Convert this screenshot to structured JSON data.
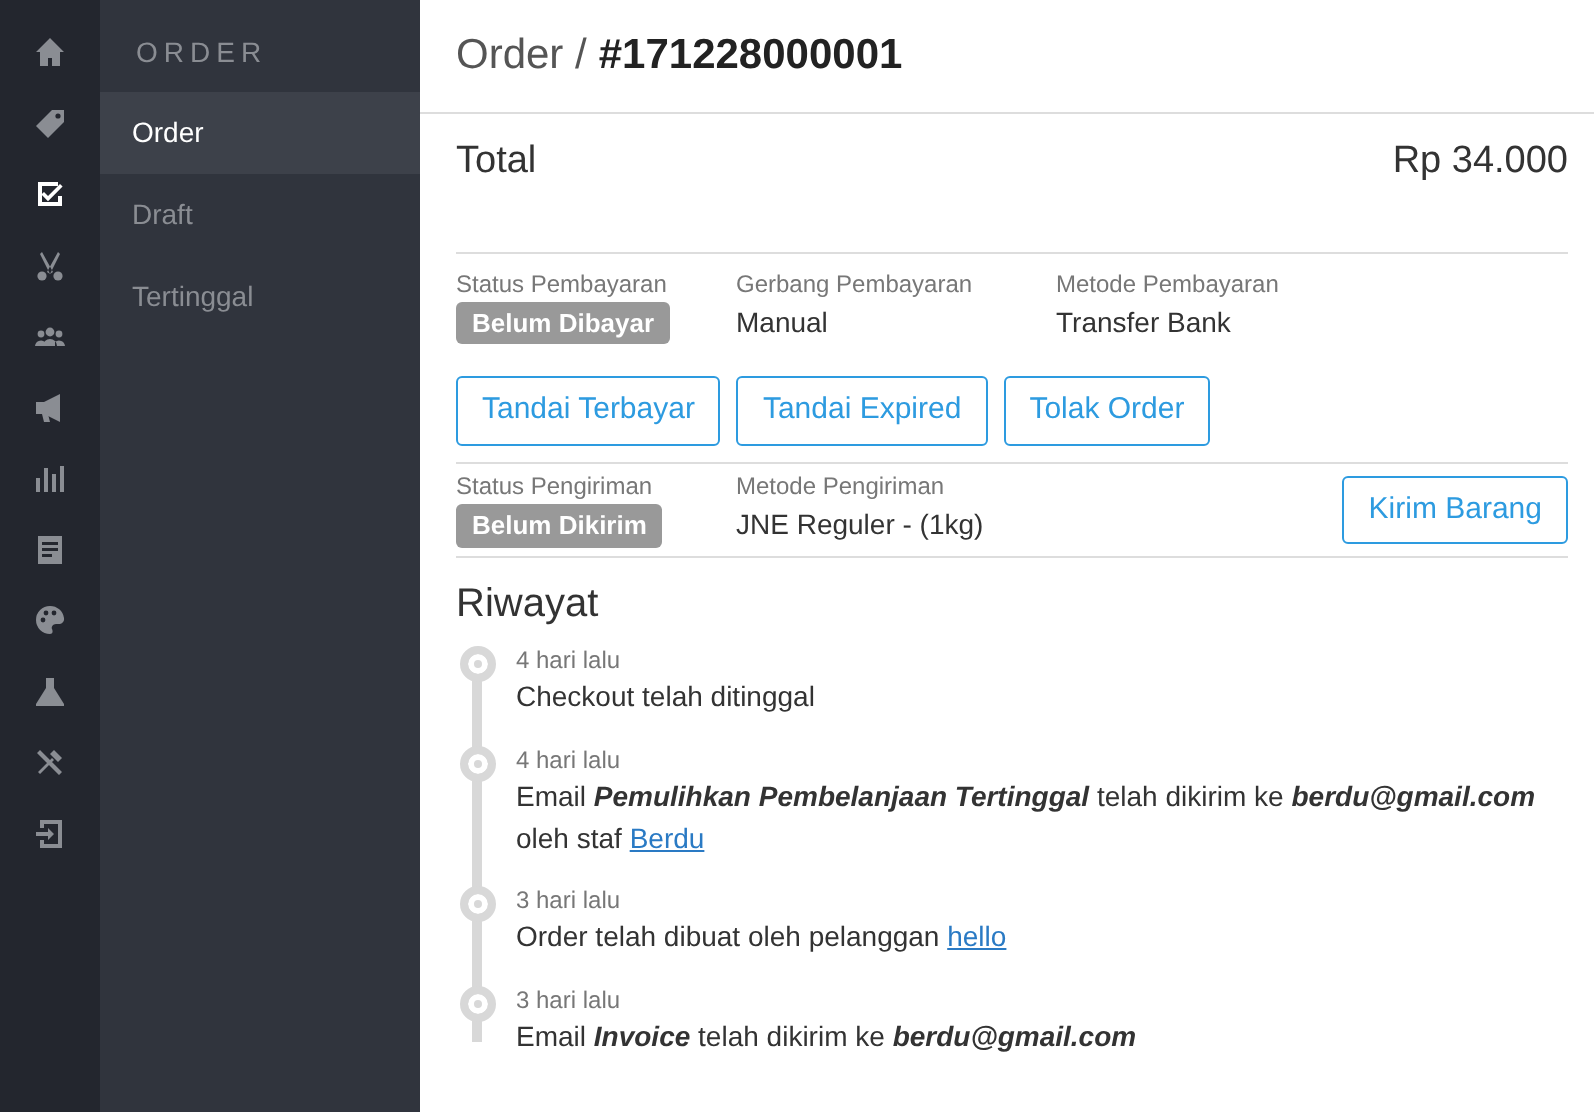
{
  "rail": [
    {
      "selected": false
    },
    {
      "selected": false
    },
    {
      "selected": true
    },
    {
      "selected": false
    },
    {
      "selected": false
    },
    {
      "selected": false
    },
    {
      "selected": false
    },
    {
      "selected": false
    },
    {
      "selected": false
    },
    {
      "selected": false
    },
    {
      "selected": false
    },
    {
      "selected": false
    }
  ],
  "sidebar": {
    "title": "ORDER",
    "items": [
      {
        "label": "Order",
        "selected": true
      },
      {
        "label": "Draft",
        "selected": false
      },
      {
        "label": "Tertinggal",
        "selected": false
      }
    ]
  },
  "header": {
    "prefix": "Order /",
    "number": "#171228000001"
  },
  "total": {
    "label": "Total",
    "value": "Rp 34.000"
  },
  "payment": {
    "fields": [
      {
        "label": "Status Pembayaran",
        "value": "Belum Dibayar",
        "kind": "badge"
      },
      {
        "label": "Gerbang Pembayaran",
        "value": "Manual",
        "kind": "text"
      },
      {
        "label": "Metode Pembayaran",
        "value": "Transfer Bank",
        "kind": "text"
      }
    ],
    "buttons": [
      "Tandai Terbayar",
      "Tandai Expired",
      "Tolak Order"
    ]
  },
  "shipping": {
    "fields": [
      {
        "label": "Status Pengiriman",
        "value": "Belum Dikirim",
        "kind": "badge"
      },
      {
        "label": "Metode Pengiriman",
        "value": "JNE Reguler - (1kg)",
        "kind": "text"
      }
    ],
    "button": "Kirim Barang"
  },
  "history": {
    "title": "Riwayat",
    "entries": [
      {
        "time": "4 hari lalu",
        "message": [
          {
            "text": "Checkout telah ditinggal"
          }
        ]
      },
      {
        "time": "4 hari lalu",
        "message": [
          {
            "text": "Email **Pemulihkan Pembelanjaan Tertinggal** telah dikirim ke **berdu@gmail.com** oleh staf "
          },
          {
            "link": "Berdu"
          }
        ]
      },
      {
        "time": "3 hari lalu",
        "message": [
          {
            "text": "Order telah dibuat oleh pelanggan "
          },
          {
            "link": "hello"
          }
        ]
      },
      {
        "time": "3 hari lalu",
        "message": [
          {
            "text": "Email **Invoice** telah dikirim ke **berdu@gmail.com**"
          }
        ]
      }
    ]
  }
}
